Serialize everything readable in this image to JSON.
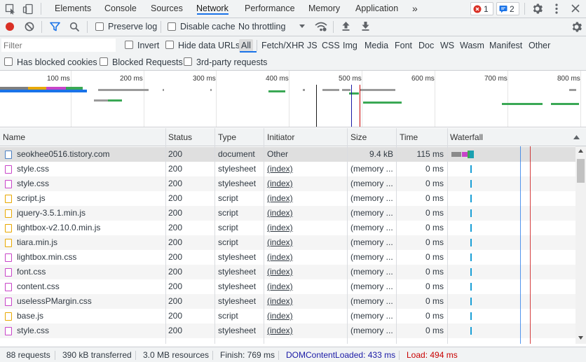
{
  "tabs": {
    "items": [
      "Elements",
      "Console",
      "Sources",
      "Network",
      "Performance",
      "Memory",
      "Application"
    ],
    "active": "Network",
    "more": "»"
  },
  "badges": {
    "errors": "1",
    "messages": "2"
  },
  "toolbar": {
    "preserve_log": "Preserve log",
    "disable_cache": "Disable cache",
    "throttling": "No throttling"
  },
  "filter": {
    "placeholder": "Filter",
    "invert": "Invert",
    "hide_data_urls": "Hide data URLs",
    "types": [
      "All",
      "Fetch/XHR",
      "JS",
      "CSS",
      "Img",
      "Media",
      "Font",
      "Doc",
      "WS",
      "Wasm",
      "Manifest",
      "Other"
    ],
    "active_type": "All",
    "has_blocked_cookies": "Has blocked cookies",
    "blocked_requests": "Blocked Requests",
    "third_party": "3rd-party requests"
  },
  "overview": {
    "ticks": [
      "100 ms",
      "200 ms",
      "300 ms",
      "400 ms",
      "500 ms",
      "600 ms",
      "700 ms",
      "800 ms"
    ]
  },
  "table": {
    "columns": [
      "Name",
      "Status",
      "Type",
      "Initiator",
      "Size",
      "Time",
      "Waterfall"
    ],
    "rows": [
      {
        "name": "seokhee0516.tistory.com",
        "status": "200",
        "type": "document",
        "initiator": "Other",
        "size": "9.4 kB",
        "time": "115 ms",
        "kind": "doc"
      },
      {
        "name": "style.css",
        "status": "200",
        "type": "stylesheet",
        "initiator": "(index)",
        "size": "(memory ...",
        "time": "0 ms",
        "kind": "css"
      },
      {
        "name": "style.css",
        "status": "200",
        "type": "stylesheet",
        "initiator": "(index)",
        "size": "(memory ...",
        "time": "0 ms",
        "kind": "css"
      },
      {
        "name": "script.js",
        "status": "200",
        "type": "script",
        "initiator": "(index)",
        "size": "(memory ...",
        "time": "0 ms",
        "kind": "js"
      },
      {
        "name": "jquery-3.5.1.min.js",
        "status": "200",
        "type": "script",
        "initiator": "(index)",
        "size": "(memory ...",
        "time": "0 ms",
        "kind": "js"
      },
      {
        "name": "lightbox-v2.10.0.min.js",
        "status": "200",
        "type": "script",
        "initiator": "(index)",
        "size": "(memory ...",
        "time": "0 ms",
        "kind": "js"
      },
      {
        "name": "tiara.min.js",
        "status": "200",
        "type": "script",
        "initiator": "(index)",
        "size": "(memory ...",
        "time": "0 ms",
        "kind": "js"
      },
      {
        "name": "lightbox.min.css",
        "status": "200",
        "type": "stylesheet",
        "initiator": "(index)",
        "size": "(memory ...",
        "time": "0 ms",
        "kind": "css"
      },
      {
        "name": "font.css",
        "status": "200",
        "type": "stylesheet",
        "initiator": "(index)",
        "size": "(memory ...",
        "time": "0 ms",
        "kind": "css"
      },
      {
        "name": "content.css",
        "status": "200",
        "type": "stylesheet",
        "initiator": "(index)",
        "size": "(memory ...",
        "time": "0 ms",
        "kind": "css"
      },
      {
        "name": "uselessPMargin.css",
        "status": "200",
        "type": "stylesheet",
        "initiator": "(index)",
        "size": "(memory ...",
        "time": "0 ms",
        "kind": "css"
      },
      {
        "name": "base.js",
        "status": "200",
        "type": "script",
        "initiator": "(index)",
        "size": "(memory ...",
        "time": "0 ms",
        "kind": "js"
      },
      {
        "name": "style.css",
        "status": "200",
        "type": "stylesheet",
        "initiator": "(index)",
        "size": "(memory ...",
        "time": "0 ms",
        "kind": "css"
      }
    ]
  },
  "status": {
    "requests": "88 requests",
    "transferred": "390 kB transferred",
    "resources": "3.0 MB resources",
    "finish": "Finish: 769 ms",
    "dom_content_loaded": "DOMContentLoaded: 433 ms",
    "load": "Load: 494 ms"
  },
  "colors": {
    "accent": "#1a73e8",
    "record": "#d93025",
    "dcl": "#1a1aa6",
    "load": "#c80000",
    "css_icon": "#c844c8",
    "js_icon": "#e8a800",
    "doc_icon": "#4a7fc1"
  }
}
